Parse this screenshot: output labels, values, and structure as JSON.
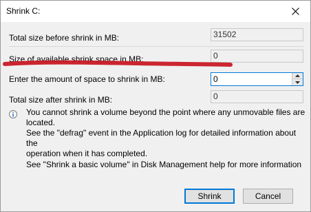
{
  "window": {
    "title": "Shrink C:"
  },
  "fields": {
    "total_before_label": "Total size before shrink in MB:",
    "total_before_value": "31502",
    "available_label": "Size of available shrink space in MB:",
    "available_value": "0",
    "enter_label": "Enter the amount of space to shrink in MB:",
    "enter_value": "0",
    "total_after_label": "Total size after shrink in MB:",
    "total_after_value": "0"
  },
  "info": {
    "icon": "info-icon",
    "lines": [
      "You cannot shrink a volume beyond the point where any unmovable files are located.",
      "See the \"defrag\" event in the Application log for detailed information about the",
      "operation when it has completed."
    ],
    "help": "See \"Shrink a basic volume\" in Disk Management help for more information"
  },
  "buttons": {
    "shrink": "Shrink",
    "cancel": "Cancel"
  },
  "colors": {
    "accent": "#0078d7",
    "annotation": "#c8141e",
    "dialog_bg": "#f0f0f0"
  }
}
